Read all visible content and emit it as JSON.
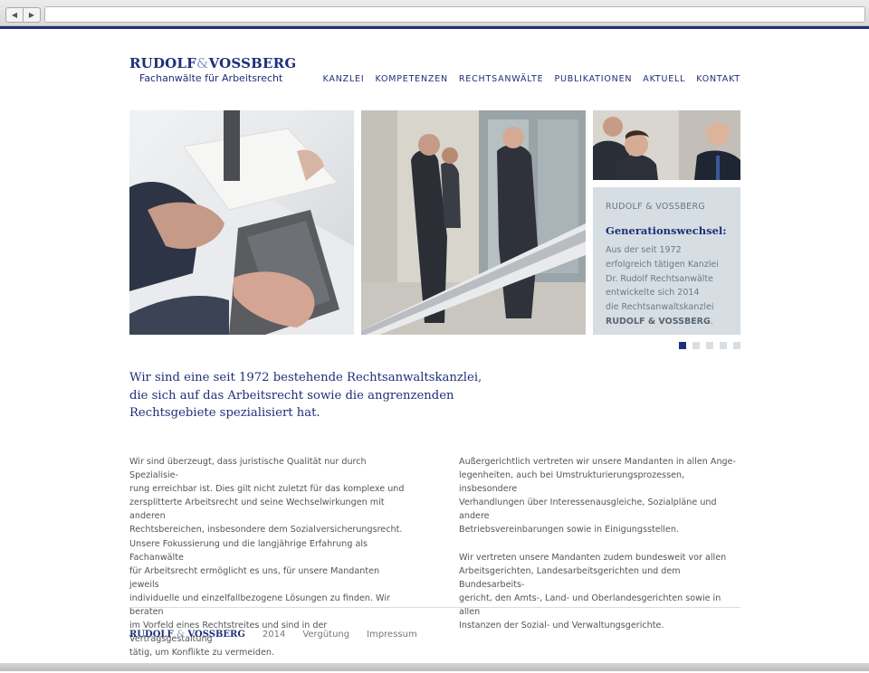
{
  "browser": {
    "back_icon": "◀",
    "forward_icon": "▶",
    "address": ""
  },
  "logo": {
    "part1": "RUDOLF",
    "amp": "&",
    "part2": "VOSSBERG",
    "tagline": "Fachanwälte für Arbeitsrecht"
  },
  "nav": [
    "KANZLEI",
    "KOMPETENZEN",
    "RECHTSANWÄLTE",
    "PUBLIKATIONEN",
    "AKTUELL",
    "KONTAKT"
  ],
  "slider": {
    "kicker": "RUDOLF & VOSSBERG",
    "headline": "Generationswechsel:",
    "body_lines": [
      "Aus der seit 1972",
      "erfolgreich tätigen Kanzlei",
      "Dr. Rudolf Rechtsanwälte",
      "entwickelte sich 2014",
      "die Rechtsanwaltskanzlei"
    ],
    "body_bold": "RUDOLF & VOSSBERG",
    "body_end": ".",
    "dots_total": 5,
    "active_index": 0
  },
  "intro": [
    "Wir sind eine seit 1972 bestehende Rechtsanwaltskanzlei,",
    "die sich auf das Arbeitsrecht sowie die angrenzenden",
    "Rechtsgebiete spezialisiert hat."
  ],
  "col1": [
    "Wir sind überzeugt, dass juristische Qualität nur durch Spezialisie-",
    "rung erreichbar ist. Dies gilt nicht zuletzt für das komplexe und",
    "zersplitterte Arbeitsrecht und seine Wechselwirkungen mit anderen",
    "Rechtsbereichen, insbesondere dem Sozialversicherungsrecht.",
    "Unsere Fokussierung und die langjährige Erfahrung als Fachanwälte",
    "für Arbeitsrecht ermöglicht es uns, für unsere Mandanten jeweils",
    "individuelle und einzelfallbezogene Lösungen zu finden. Wir beraten",
    "im Vorfeld eines Rechtstreites und sind in der Vertragsgestaltung",
    "tätig, um Konflikte zu vermeiden."
  ],
  "col2_p1": [
    "Außergerichtlich vertreten wir unsere Mandanten in allen Ange-",
    "legenheiten, auch bei Umstrukturierungsprozessen, insbesondere",
    "Verhandlungen über Interessenausgleiche, Sozialpläne und andere",
    "Betriebsvereinbarungen sowie in Einigungsstellen."
  ],
  "col2_p2": [
    "Wir vertreten unsere Mandanten zudem bundesweit vor allen",
    "Arbeitsgerichten, Landesarbeitsgerichten und dem Bundesarbeits-",
    "gericht, den Amts-, Land- und Oberlandesgerichten sowie in allen",
    "Instanzen der Sozial- und Verwaltungsgerichte."
  ],
  "footer": {
    "logo_part1": "RUDOLF",
    "logo_amp": "&",
    "logo_part2": "VOSSBERG",
    "year": "2014",
    "link1": "Vergütung",
    "link2": "Impressum"
  },
  "colors": {
    "brand": "#1f2f78",
    "card_bg": "#d6dde3",
    "dot_inactive": "#d9dee2"
  }
}
